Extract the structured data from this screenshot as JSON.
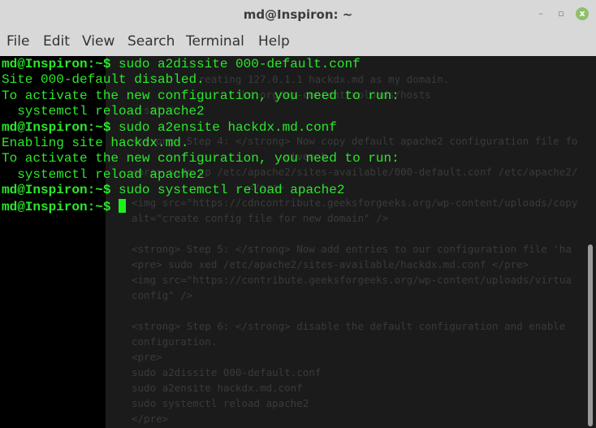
{
  "window": {
    "title": "md@Inspiron: ~",
    "minimize": "–",
    "maximize": "▫",
    "close": "x"
  },
  "menu": [
    "File",
    "Edit",
    "View",
    "Search",
    "Terminal",
    "Help"
  ],
  "terminal_lines": [
    {
      "prompt": "md@Inspiron:~$",
      "text": " sudo a2dissite 000-default.conf"
    },
    {
      "prompt": "",
      "text": "Site 000-default disabled."
    },
    {
      "prompt": "",
      "text": "To activate the new configuration, you need to run:"
    },
    {
      "prompt": "",
      "text": "  systemctl reload apache2"
    },
    {
      "prompt": "md@Inspiron:~$",
      "text": " sudo a2ensite hackdx.md.conf"
    },
    {
      "prompt": "",
      "text": "Enabling site hackdx.md."
    },
    {
      "prompt": "",
      "text": "To activate the new configuration, you need to run:"
    },
    {
      "prompt": "",
      "text": "  systemctl reload apache2"
    },
    {
      "prompt": "md@Inspiron:~$",
      "text": " sudo systemctl reload apache2"
    },
    {
      "prompt": "md@Inspiron:~$",
      "text": " "
    }
  ],
  "background_editor_lines": [
    "           reating 127.0.1.1 hackdx.md as my domain.",
    "                  ks.org/wp-content/uploads/hosts",
    "  st\" />",
    "",
    "<strong> Step 4: </strong> Now copy default apache2 configuration file fo",
    "                         given b",
    "<pre> sudo cp /etc/apache2/sites-available/000-default.conf /etc/apache2/",
    "                   </pre>",
    "<img src=\"https://cdncontribute.geeksforgeeks.org/wp-content/uploads/copy",
    "alt=\"create config file for new domain\" />",
    "",
    "<strong> Step 5: </strong> Now add entries to our configuration file 'ha",
    "<pre> sudo xed /etc/apache2/sites-available/hackdx.md.conf </pre>",
    "<img src=\"https://contribute.geeksforgeeks.org/wp-content/uploads/virtua",
    "config\" />",
    "",
    "<strong> Step 6: </strong> disable the default configuration and enable",
    "configuration.",
    "<pre>",
    "sudo a2dissite 000-default.conf",
    "sudo a2ensite hackdx.md.conf",
    "sudo systemctl reload apache2",
    "</pre>"
  ]
}
